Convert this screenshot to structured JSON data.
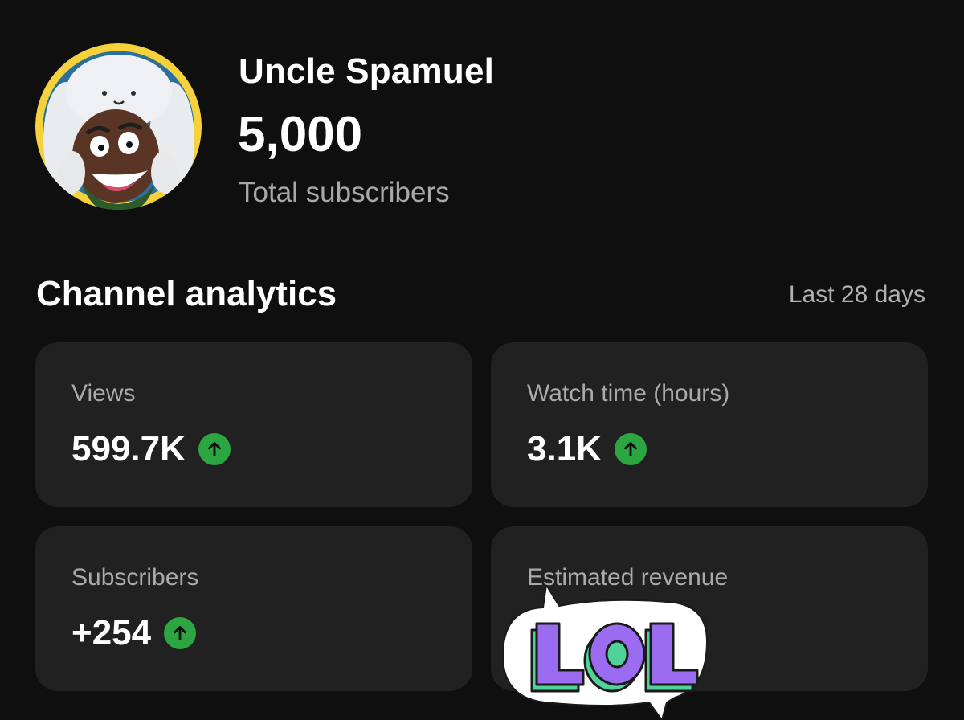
{
  "channel": {
    "name": "Uncle Spamuel",
    "subscriber_count": "5,000",
    "subscriber_label": "Total subscribers",
    "avatar_icon": "channel-avatar"
  },
  "analytics": {
    "title": "Channel analytics",
    "period": "Last 28 days",
    "cards": [
      {
        "label": "Views",
        "value": "599.7K",
        "trend": "up"
      },
      {
        "label": "Watch time (hours)",
        "value": "3.1K",
        "trend": "up"
      },
      {
        "label": "Subscribers",
        "value": "+254",
        "trend": "up"
      },
      {
        "label": "Estimated revenue",
        "value": "",
        "trend": ""
      }
    ]
  },
  "sticker": {
    "text": "LOL",
    "fill_color": "#9b6cf0",
    "side_color": "#4fd39a",
    "outline_color": "#1a1a1a",
    "bubble_color": "#ffffff"
  },
  "colors": {
    "background": "#0f0f0f",
    "card": "#212121",
    "trend_up": "#2ba640",
    "avatar_ring": "#f5d23c"
  },
  "icons": {
    "trend": "arrow-up-icon"
  }
}
